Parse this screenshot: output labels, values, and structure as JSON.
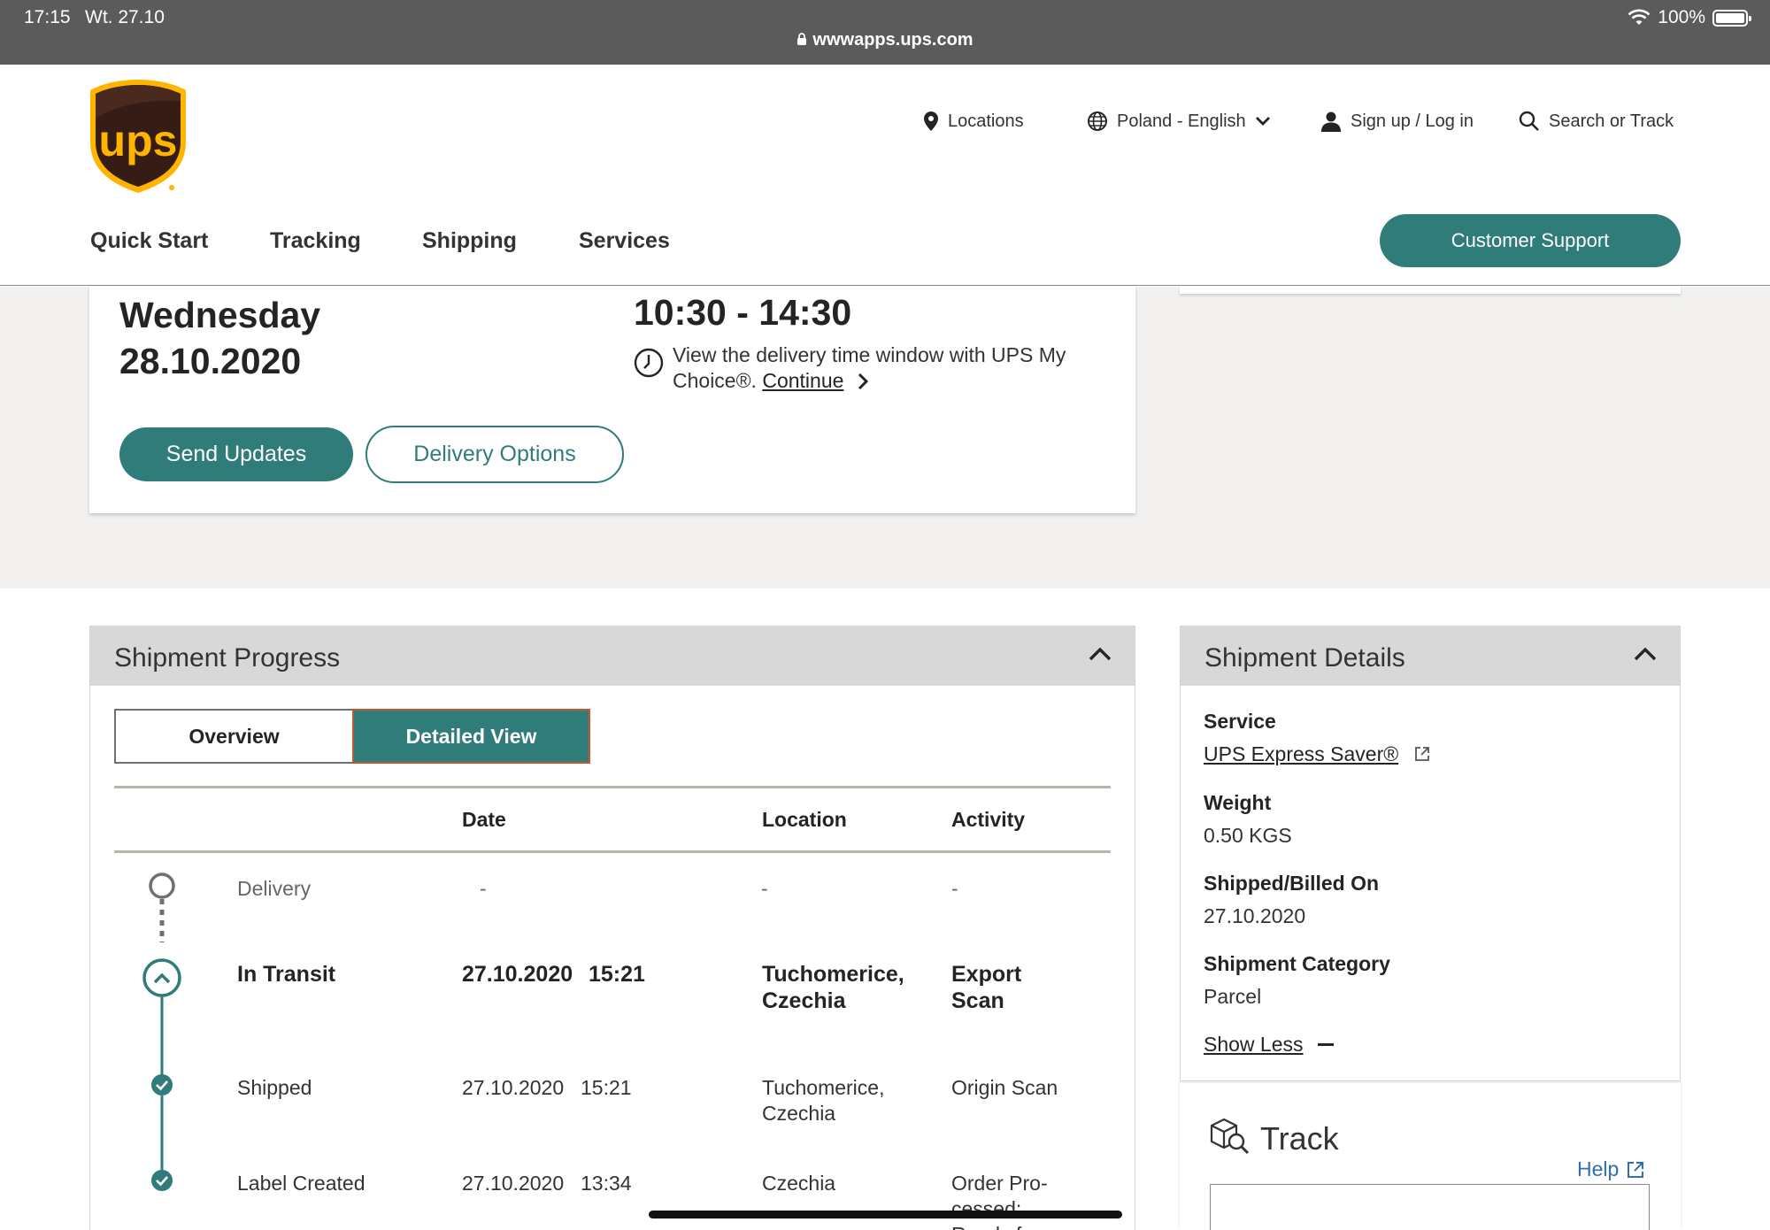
{
  "statusbar": {
    "time": "17:15",
    "date": "Wt. 27.10",
    "battery": "100%",
    "url": "wwwapps.ups.com"
  },
  "header": {
    "utility": {
      "locations": "Locations",
      "language": "Poland - English",
      "signin": "Sign up / Log in",
      "search": "Search or Track"
    },
    "nav": [
      "Quick Start",
      "Tracking",
      "Shipping",
      "Services"
    ],
    "support": "Customer Support"
  },
  "delivery": {
    "day": "Wednesday",
    "date": "28.10.2020",
    "window": "10:30 - 14:30",
    "mychoice_text": "View the delivery time window with UPS My Choice®.",
    "continue": "Continue",
    "send_updates": "Send Updates",
    "delivery_options": "Delivery Options"
  },
  "progress": {
    "title": "Shipment Progress",
    "tabs": {
      "overview": "Overview",
      "detailed": "Detailed View"
    },
    "columns": {
      "date": "Date",
      "location": "Location",
      "activity": "Activity"
    },
    "rows": [
      {
        "status": "Delivery",
        "date": "-",
        "location": "-",
        "activity": "-"
      },
      {
        "status": "In Transit",
        "date": "27.10.2020",
        "time": "15:21",
        "location1": "Tuchomerice,",
        "location2": "Czechia",
        "activity1": "Export",
        "activity2": "Scan"
      },
      {
        "status": "Shipped",
        "date": "27.10.2020",
        "time": "15:21",
        "location1": "Tuchomerice,",
        "location2": "Czechia",
        "activity": "Origin Scan"
      },
      {
        "status": "Label Created",
        "date": "27.10.2020",
        "time": "13:34",
        "location": "Czechia",
        "activity1": "Order Pro-",
        "activity2": "cessed:",
        "activity3": "Ready for"
      }
    ]
  },
  "details": {
    "title": "Shipment Details",
    "service_label": "Service",
    "service_value": "UPS Express Saver®",
    "weight_label": "Weight",
    "weight_value": "0.50 KGS",
    "shipped_label": "Shipped/Billed On",
    "shipped_value": "27.10.2020",
    "category_label": "Shipment Category",
    "category_value": "Parcel",
    "show_less": "Show Less"
  },
  "track": {
    "title": "Track",
    "help": "Help"
  },
  "colors": {
    "teal": "#2f7c7b",
    "brand_brown": "#351c15",
    "brand_gold": "#ffb500"
  },
  "icons": [
    "wifi-icon",
    "battery-icon",
    "lock-icon",
    "location-pin-icon",
    "globe-icon",
    "chevron-down-icon",
    "user-icon",
    "search-icon",
    "clock-icon",
    "chevron-right-icon",
    "chevron-up-icon",
    "external-link-icon",
    "package-search-icon"
  ]
}
